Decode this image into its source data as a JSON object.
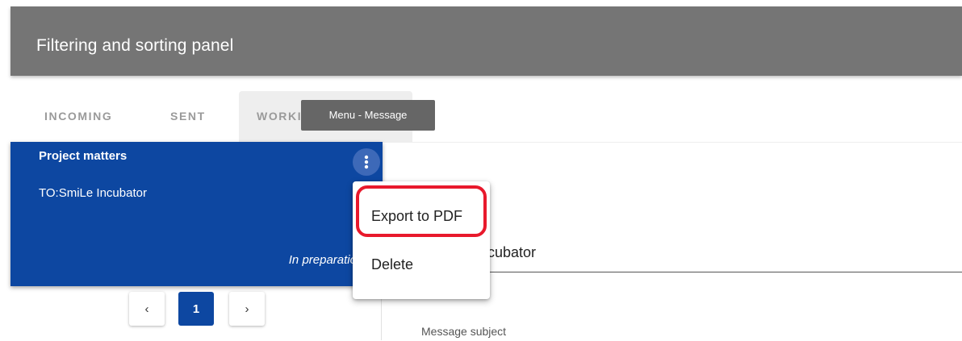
{
  "header": {
    "title": "Filtering and sorting panel"
  },
  "tabs": [
    {
      "label": "INCOMING"
    },
    {
      "label": "SENT"
    },
    {
      "label": "WORKIN"
    }
  ],
  "tooltip": {
    "text": "Menu - Message"
  },
  "message_card": {
    "title": "Project matters",
    "to": "TO:SmiLe Incubator",
    "status": "In preparatio",
    "menu_icon": "more-vertical-icon"
  },
  "context_menu": {
    "items": [
      {
        "label": "Export to PDF",
        "highlighted": true
      },
      {
        "label": "Delete"
      }
    ]
  },
  "pagination": {
    "prev_label": "‹",
    "current_page": "1",
    "next_label": "›"
  },
  "form": {
    "recipient_value": "cubator",
    "subject_label": "Message subject"
  },
  "colors": {
    "header_bg": "#757575",
    "card_bg": "#0d47a1",
    "highlight": "#e8192c"
  }
}
